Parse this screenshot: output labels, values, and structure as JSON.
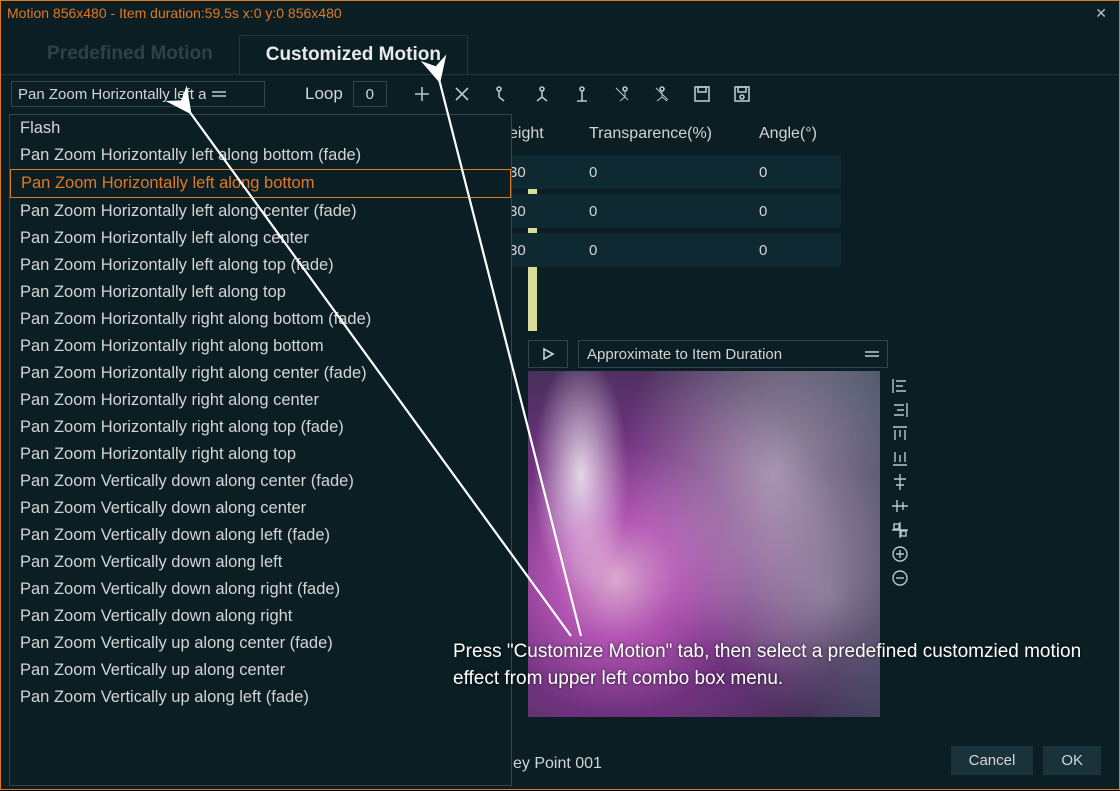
{
  "titlebar": "Motion 856x480 - Item duration:59.5s x:0 y:0 856x480",
  "tabs": {
    "predefined": "Predefined Motion",
    "customized": "Customized Motion"
  },
  "combo_value": "Pan Zoom Horizontally left a",
  "loop_label": "Loop",
  "loop_value": "0",
  "columns": {
    "height": "eight",
    "transparence": "Transparence(%)",
    "angle": "Angle(°)"
  },
  "rows": [
    {
      "height": "30",
      "trans": "0",
      "angle": "0"
    },
    {
      "height": "30",
      "trans": "0",
      "angle": "0"
    },
    {
      "height": "30",
      "trans": "0",
      "angle": "0"
    }
  ],
  "dropdown_items": [
    "Flash",
    "Pan Zoom Horizontally left along bottom (fade)",
    "Pan Zoom Horizontally left along bottom",
    "Pan Zoom Horizontally left along center (fade)",
    "Pan Zoom Horizontally left along center",
    "Pan Zoom Horizontally left along top (fade)",
    "Pan Zoom Horizontally left along top",
    "Pan Zoom Horizontally right along bottom (fade)",
    "Pan Zoom Horizontally right along bottom",
    "Pan Zoom Horizontally right along center (fade)",
    "Pan Zoom Horizontally right along center",
    "Pan Zoom Horizontally right along top (fade)",
    "Pan Zoom Horizontally right along top",
    "Pan Zoom Vertically down along center (fade)",
    "Pan Zoom Vertically down along center",
    "Pan Zoom Vertically down along left (fade)",
    "Pan Zoom Vertically down along left",
    "Pan Zoom Vertically down along right (fade)",
    "Pan Zoom Vertically down along right",
    "Pan Zoom Vertically up along center (fade)",
    "Pan Zoom Vertically up along center",
    "Pan Zoom Vertically up along left (fade)"
  ],
  "dropdown_selected_index": 2,
  "approx_label": "Approximate to Item Duration",
  "keypoint_label": "ey Point 001",
  "buttons": {
    "cancel": "Cancel",
    "ok": "OK"
  },
  "annotation": "Press \"Customize Motion\" tab, then select a predefined customzied motion effect from upper left combo box menu."
}
